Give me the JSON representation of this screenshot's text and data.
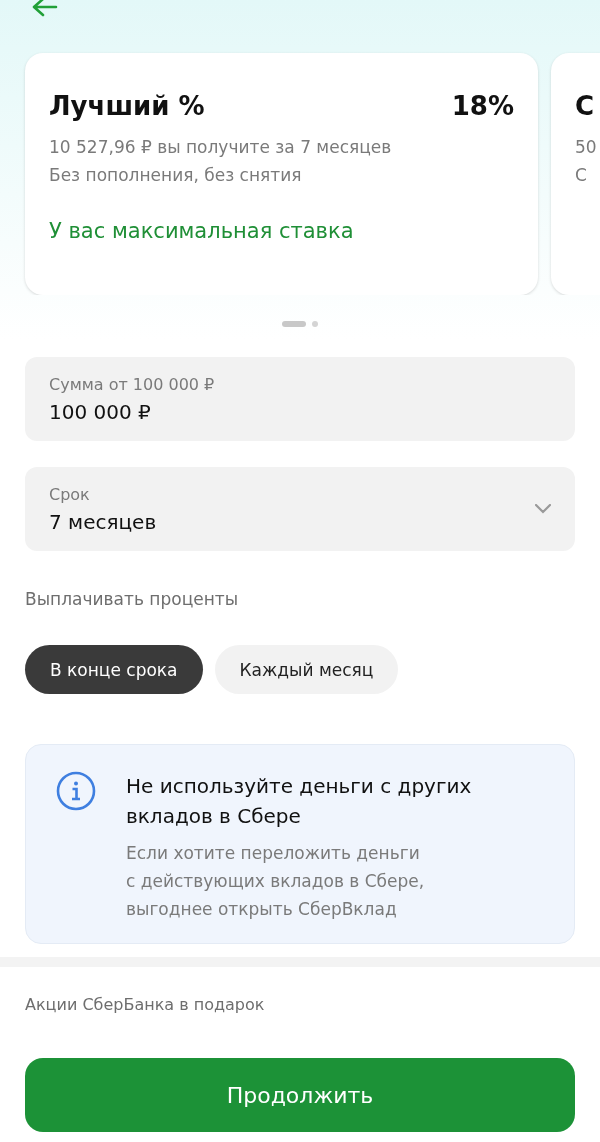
{
  "offers": [
    {
      "title": "Лучший %",
      "rate": "18%",
      "lines": [
        "10 527,96 ₽ вы получите за 7 месяцев",
        "Без пополнения, без снятия"
      ],
      "note": "У вас максимальная ставка"
    },
    {
      "title": "С",
      "lines": [
        "50",
        "С"
      ]
    }
  ],
  "pager": [
    {
      "selected": true
    },
    {
      "selected": false
    }
  ],
  "fields": [
    {
      "kind": "input",
      "label": "Сумма от 100 000 ₽",
      "value": "100 000 ₽"
    },
    {
      "kind": "select",
      "label": "Срок",
      "value": "7 месяцев"
    }
  ],
  "payout": {
    "label": "Выплачивать проценты",
    "options": [
      {
        "label": "В конце срока",
        "selected": true
      },
      {
        "label": "Каждый месяц",
        "selected": false
      }
    ]
  },
  "info": {
    "title": "Не используйте деньги с других вкладов в Сбере",
    "text": "Если хотите переложить деньги с действующих вкладов в Сбере, выгоднее открыть СберВклад"
  },
  "promo": {
    "label": "Акции СберБанка в подарок"
  },
  "continue_button": "Продолжить"
}
